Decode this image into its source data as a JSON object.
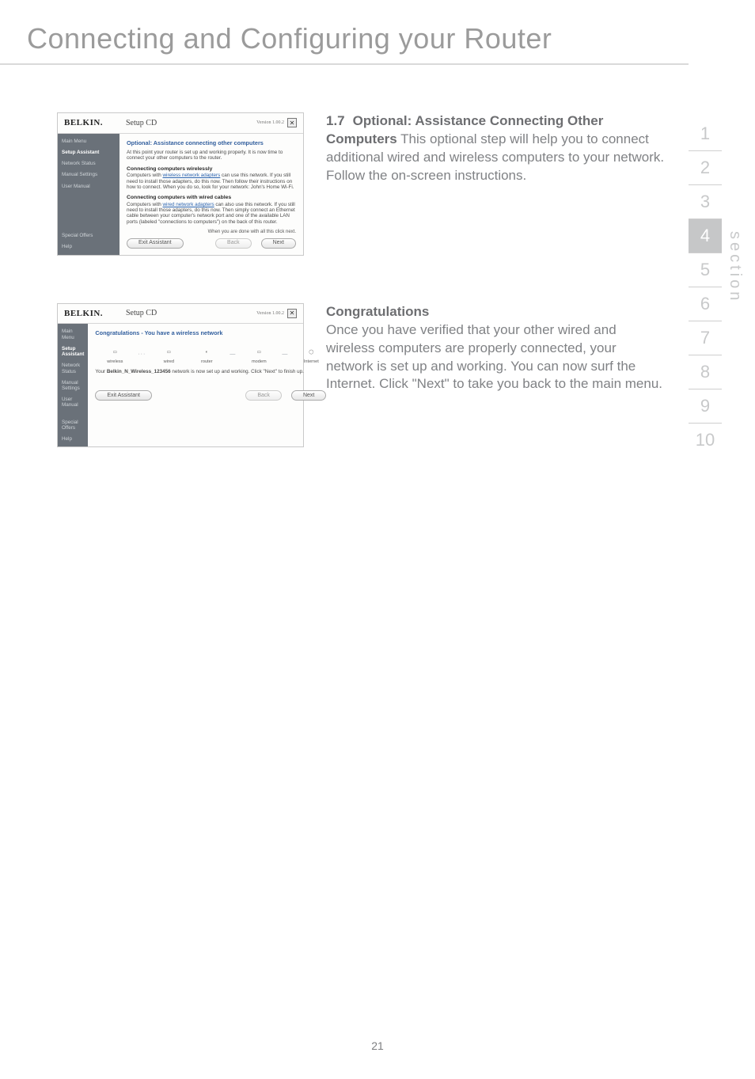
{
  "page_title": "Connecting and Configuring your Router",
  "page_number": "21",
  "section_label": "section",
  "side_nav": {
    "items": [
      "1",
      "2",
      "3",
      "4",
      "5",
      "6",
      "7",
      "8",
      "9",
      "10"
    ],
    "active_index": 3
  },
  "step": {
    "marker": "1.7",
    "heading": "Optional: Assistance Connecting Other Computers",
    "body": "This optional step will help you to connect additional wired and wireless computers to your network. Follow the on-screen instructions."
  },
  "congrats": {
    "heading": "Congratulations",
    "body": "Once you have verified that your other wired and wireless computers are properly connected, your network is set up and working. You can now surf the Internet. Click \"Next\" to take you back to the main menu."
  },
  "shot_common": {
    "brand": "BELKIN.",
    "top_title": "Setup CD",
    "version": "Version 1.00.2",
    "side_items": {
      "main_menu": "Main Menu",
      "setup_assistant": "Setup Assistant",
      "network_status": "Network Status",
      "manual_settings": "Manual Settings",
      "user_manual": "User Manual",
      "special_offers": "Special Offers",
      "help": "Help"
    },
    "btn_exit": "Exit Assistant",
    "btn_back": "Back",
    "btn_next": "Next"
  },
  "shot1": {
    "title": "Optional: Assistance connecting other computers",
    "intro": "At this point your router is set up and working properly. It is now time to connect your other computers to the router.",
    "sub1": "Connecting computers wirelessly",
    "p1a": "Computers with ",
    "p1_link": "wireless network adapters",
    "p1b": " can use this network. If you still need to install those adapters, do this now. Then follow their instructions on how to connect. When you do so, look for your network: John's Home Wi-Fi.",
    "sub2": "Connecting computers with wired cables",
    "p2a": "Computers with ",
    "p2_link": "wired network adapters",
    "p2b": " can also use this network. If you still need to install those adapters, do this now. Then simply connect an Ethernet cable between your computer's network port and one of the available LAN ports (labeled \"connections to computers\") on the back of this router.",
    "hint": "When you are done with all this click next."
  },
  "shot2": {
    "title": "Congratulations - You have a wireless network",
    "icons": {
      "wireless": "wireless",
      "wired": "wired",
      "router": "router",
      "modem": "modem",
      "internet": "Internet"
    },
    "msg_a": "Your ",
    "msg_b": "Belkin_N_Wireless_123456",
    "msg_c": " network is now set up and working. Click \"Next\" to finish up."
  }
}
